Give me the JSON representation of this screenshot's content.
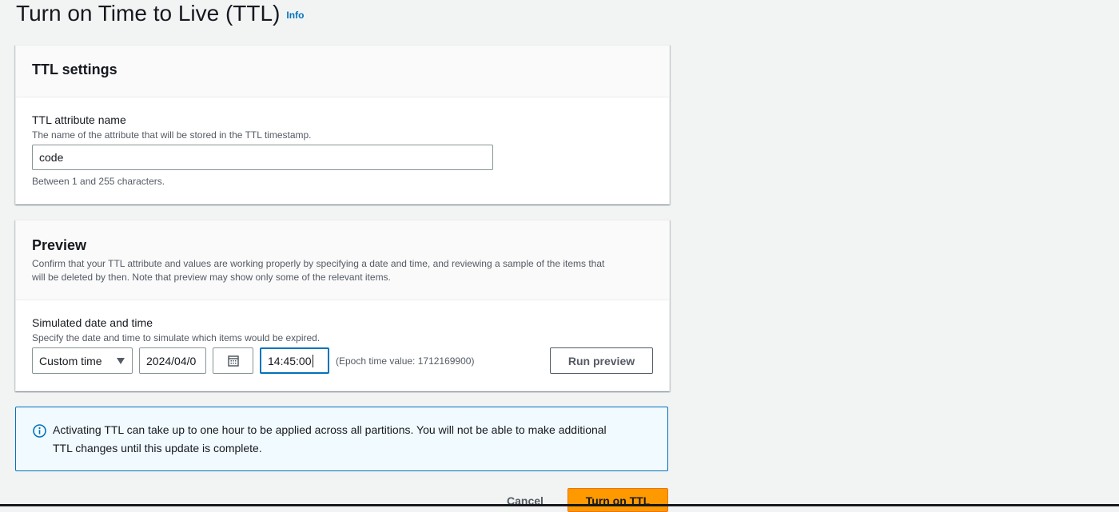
{
  "page": {
    "title": "Turn on Time to Live (TTL)",
    "info_link": "Info"
  },
  "ttl_settings": {
    "heading": "TTL settings",
    "attribute_label": "TTL attribute name",
    "attribute_description": "The name of the attribute that will be stored in the TTL timestamp.",
    "attribute_value": "code",
    "constraint_text": "Between 1 and 255 characters."
  },
  "preview": {
    "heading": "Preview",
    "description_line1": "Confirm that your TTL attribute and values are working properly by specifying a date and time, and reviewing a sample of the items that",
    "description_line2": "will be deleted by then. Note that preview may show only some of the relevant items.",
    "simulated_label": "Simulated date and time",
    "simulated_description": "Specify the date and time to simulate which items would be expired.",
    "time_mode_selected": "Custom time",
    "date_value": "2024/04/0",
    "time_value": "14:45:00",
    "epoch_text": "(Epoch time value: 1712169900)",
    "run_preview_label": "Run preview"
  },
  "alert": {
    "line1": "Activating TTL can take up to one hour to be applied across all partitions. You will not be able to make additional",
    "line2": "TTL changes until this update is complete.",
    "icon": "info-circle-icon"
  },
  "actions": {
    "cancel_label": "Cancel",
    "submit_label": "Turn on TTL"
  },
  "colors": {
    "primary": "#ff9900",
    "link": "#0073bb",
    "background": "#f2f3f3"
  }
}
